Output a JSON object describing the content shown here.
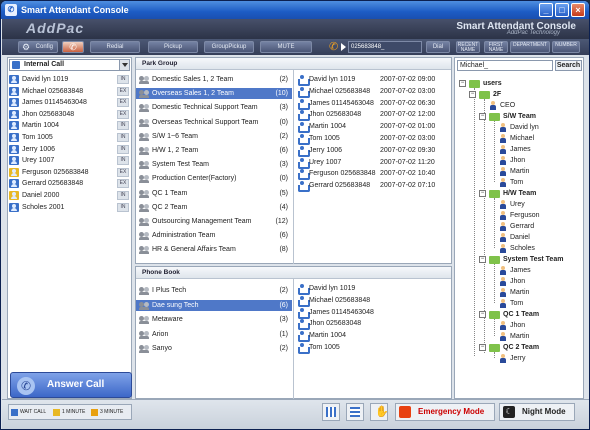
{
  "window": {
    "title": "Smart Attendant Console",
    "brand": "AddPac",
    "console_name": "Smart Attendant Console",
    "console_sub": "AddPac Technology"
  },
  "toolbar": {
    "config": "Config",
    "redial": "Redial",
    "pickup": "Pickup",
    "group_pickup": "GroupPickup",
    "mute": "MUTE",
    "number": "025683848_",
    "dial": "Dial",
    "recent_name": "RECENT NAME",
    "first_name": "FIRST NAME",
    "department": "DEPARTMENT",
    "number_btn": "NUMBER"
  },
  "left": {
    "dropdown": "Internal Call",
    "items": [
      {
        "name": "David lyn 1019",
        "badge": "IN",
        "color": "b"
      },
      {
        "name": "Michael 025683848",
        "badge": "EX",
        "color": "b"
      },
      {
        "name": "James 01145463048",
        "badge": "EX",
        "color": "b"
      },
      {
        "name": "Jhon 025683048",
        "badge": "EX",
        "color": "b"
      },
      {
        "name": "Martin 1004",
        "badge": "IN",
        "color": "b"
      },
      {
        "name": "Tom 1005",
        "badge": "IN",
        "color": "b"
      },
      {
        "name": "Jerry 1006",
        "badge": "IN",
        "color": "b"
      },
      {
        "name": "Urey 1007",
        "badge": "IN",
        "color": "b"
      },
      {
        "name": "Ferguson 025683848",
        "badge": "EX",
        "color": "y"
      },
      {
        "name": "Gerrard 025683848",
        "badge": "EX",
        "color": "b"
      },
      {
        "name": "Daniel 2000",
        "badge": "IN",
        "color": "y"
      },
      {
        "name": "Scholes 2001",
        "badge": "IN",
        "color": "b"
      }
    ],
    "answer": "Answer Call"
  },
  "park": {
    "title": "Park Group",
    "groups": [
      {
        "name": "Domestic Sales 1, 2 Team",
        "count": "(2)"
      },
      {
        "name": "Overseas Sales 1, 2 Team",
        "count": "(10)"
      },
      {
        "name": "Domestic Technical Support Team",
        "count": "(3)"
      },
      {
        "name": "Overseas Technical Support Team",
        "count": "(0)"
      },
      {
        "name": "S/W 1~6 Team",
        "count": "(2)"
      },
      {
        "name": "H/W 1, 2 Team",
        "count": "(6)"
      },
      {
        "name": "System Test Team",
        "count": "(3)"
      },
      {
        "name": "Production Center(Factory)",
        "count": "(0)"
      },
      {
        "name": "QC 1 Team",
        "count": "(5)"
      },
      {
        "name": "QC 2 Team",
        "count": "(4)"
      },
      {
        "name": "Outsourcing Management Team",
        "count": "(12)"
      },
      {
        "name": "Administration Team",
        "count": "(6)"
      },
      {
        "name": "HR & General Affairs Team",
        "count": "(8)"
      }
    ],
    "calls": [
      {
        "name": "David lyn 1019",
        "time": "2007-07-02 09:00"
      },
      {
        "name": "Michael 025683848",
        "time": "2007-07-02 03:00"
      },
      {
        "name": "James 01145463048",
        "time": "2007-07-02 06:30"
      },
      {
        "name": "Jhon 025683048",
        "time": "2007-07-02 12:00"
      },
      {
        "name": "Martin 1004",
        "time": "2007-07-02 01:00"
      },
      {
        "name": "Tom 1005",
        "time": "2007-07-02 03:00"
      },
      {
        "name": "Jerry 1006",
        "time": "2007-07-02 09:30"
      },
      {
        "name": "Urey 1007",
        "time": "2007-07-02 11:20"
      },
      {
        "name": "Ferguson 025683848",
        "time": "2007-07-02 10:40"
      },
      {
        "name": "Gerrard 025683848",
        "time": "2007-07-02 07:10"
      }
    ]
  },
  "phonebook": {
    "title": "Phone Book",
    "groups": [
      {
        "name": "I Plus Tech",
        "count": "(2)"
      },
      {
        "name": "Dae sung Tech",
        "count": "(6)"
      },
      {
        "name": "Metaware",
        "count": "(3)"
      },
      {
        "name": "Arion",
        "count": "(1)"
      },
      {
        "name": "Sanyo",
        "count": "(2)"
      }
    ],
    "contacts": [
      "David lyn 1019",
      "Michael 025683848",
      "James 01145463048",
      "Jhon 025683048",
      "Martin 1004",
      "Tom 1005"
    ]
  },
  "tree": {
    "search": "Michael_",
    "search_btn": "Search",
    "root": "users",
    "floor": "2F",
    "ceo": "CEO",
    "sw": "S/W Team",
    "sw_members": [
      "David lyn",
      "Michael",
      "James",
      "Jhon",
      "Martin",
      "Tom"
    ],
    "hw": "H/W Team",
    "hw_members": [
      "Urey",
      "Ferguson",
      "Gerrard",
      "Daniel",
      "Scholes"
    ],
    "st": "System Test Team",
    "st_members": [
      "James",
      "Jhon",
      "Martin",
      "Tom"
    ],
    "qc1": "QC 1 Team",
    "qc1_members": [
      "Jhon",
      "Martin"
    ],
    "qc2": "QC 2 Team",
    "qc2_members": [
      "Jerry"
    ]
  },
  "status": {
    "wait_call": "WAIT CALL",
    "one_minute": "1 MINUTE",
    "three_minute": "3 MINUTE",
    "emergency": "Emergency Mode",
    "night": "Night Mode"
  },
  "colors": {
    "emergency": "#cc0000",
    "accent": "#1d5cc4"
  }
}
